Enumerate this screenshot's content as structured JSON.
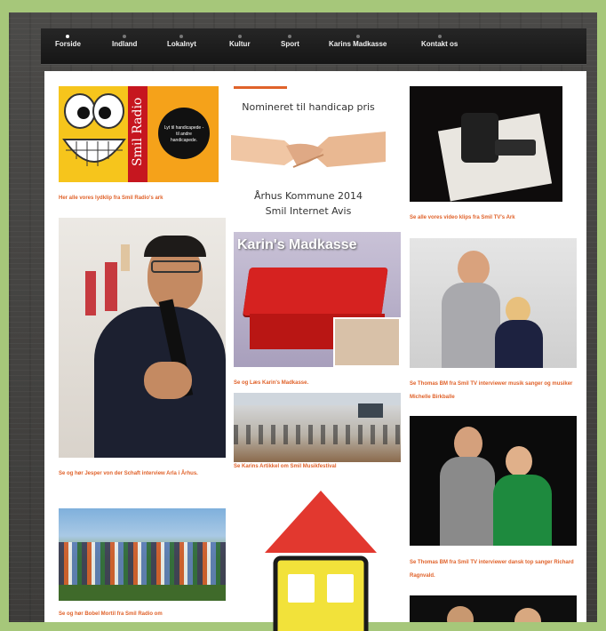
{
  "nav": {
    "items": [
      "Forside",
      "Indland",
      "Lokalnyt",
      "Kultur",
      "Sport",
      "Karins Madkasse",
      "Kontakt os"
    ],
    "active_index": 0
  },
  "left": {
    "radio_logo": {
      "vertical_text": "Smil Radio",
      "badge_text": "Lyt til handicapede - til andre handicapede."
    },
    "caption1": "Her alle vores lydklip fra Smil Radio's ark",
    "caption2": "Se og hør Jesper von der Schaft interview Arla i Århus.",
    "caption3": "Se og hør Bobel Mortil fra Smil Radio om"
  },
  "center": {
    "handicap": {
      "line1": "Nomineret til handicap pris",
      "line2": "Århus Kommune 2014",
      "line3": "Smil Internet Avis"
    },
    "madkasse_title": "Karin's Madkasse",
    "caption1": "Se og Læs Karin's Madkasse.",
    "caption2": "Se Karins Artikkel om Smil Musikfestival"
  },
  "right": {
    "caption1": "Se alle vores video klips fra Smil TV's Ark",
    "caption2": "Se Thomas BM fra Smil TV interviewer musik sanger og musiker Michelle Birkballe",
    "caption3": "Se Thomas BM fra Smil TV interviewer dansk top sanger Richard Ragnvald."
  },
  "colors": {
    "accent": "#e0622a",
    "nav": "#1d1d1d",
    "background": "#a6c77a"
  }
}
